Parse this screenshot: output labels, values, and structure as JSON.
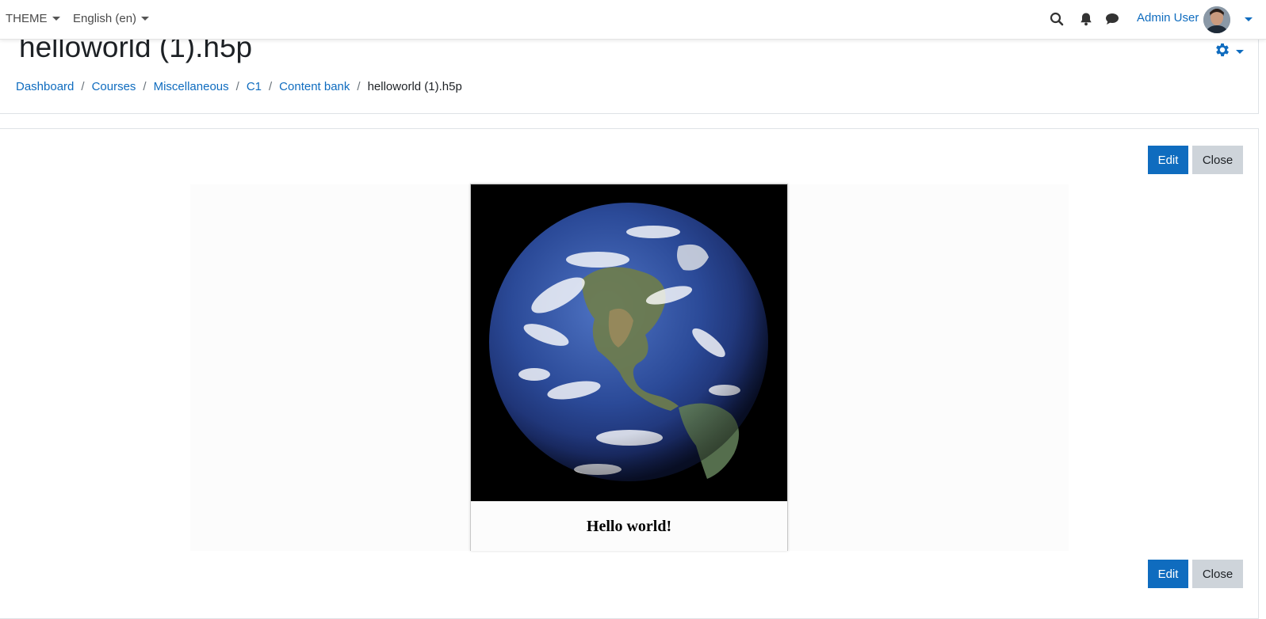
{
  "navbar": {
    "theme_label": "THEME",
    "language_label": "English (en)",
    "user_name": "Admin User",
    "icons": [
      "search-icon",
      "bell-icon",
      "chat-icon"
    ]
  },
  "header": {
    "title": "helloworld (1).h5p",
    "breadcrumb": [
      "Dashboard",
      "Courses",
      "Miscellaneous",
      "C1",
      "Content bank",
      "helloworld (1).h5p"
    ]
  },
  "actions": {
    "edit_label": "Edit",
    "close_label": "Close"
  },
  "h5p": {
    "caption": "Hello world!"
  },
  "colors": {
    "link": "#0f6cbf",
    "primary": "#0f6cbf",
    "secondary": "#ced4da"
  }
}
